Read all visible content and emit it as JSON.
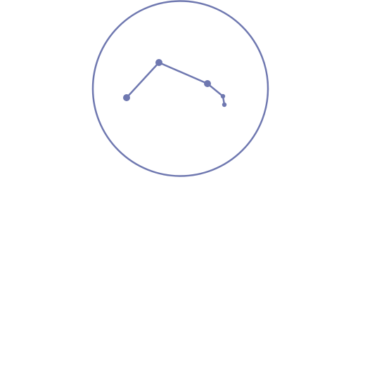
{
  "icon": {
    "name": "constellation-icon",
    "color": "#6f78b0",
    "points": 5
  }
}
